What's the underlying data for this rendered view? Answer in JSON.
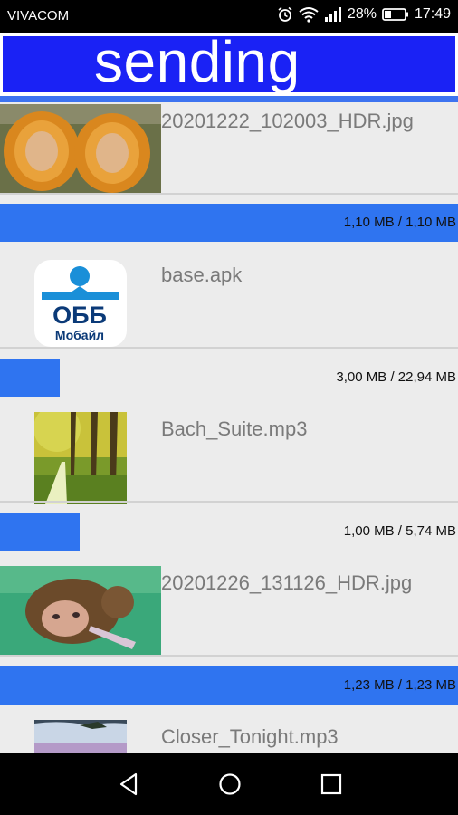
{
  "status_bar": {
    "carrier": "VIVACOM",
    "battery": "28%",
    "time": "17:49",
    "icons": [
      "alarm-icon",
      "wifi-icon",
      "signal-icon",
      "battery-icon"
    ]
  },
  "header": {
    "title": "sending"
  },
  "colors": {
    "header_bg": "#1a22f5",
    "progress_fill": "#2f74f0",
    "text_gray": "#7a7a7a"
  },
  "files": [
    {
      "name": "20201222_102003_HDR.jpg",
      "thumb": "pumpkin-photo",
      "progress_text": "1,10 MB / 1,10 MB",
      "progress_fraction": 1.0
    },
    {
      "name": "base.apk",
      "thumb": "obb-mobile-app-icon",
      "thumb_text_top": "ОББ",
      "thumb_text_bottom": "Мобайл",
      "progress_text": "3,00 MB / 22,94 MB",
      "progress_fraction": 0.13
    },
    {
      "name": "Bach_Suite.mp3",
      "thumb": "park-trees-photo",
      "progress_text": "1,00 MB / 5,74 MB",
      "progress_fraction": 0.174
    },
    {
      "name": "20201226_131126_HDR.jpg",
      "thumb": "curly-hair-doll-photo",
      "progress_text": "1,23 MB / 1,23 MB",
      "progress_fraction": 1.0
    },
    {
      "name": "Closer_Tonight.mp3",
      "thumb": "beach-palm-photo"
    }
  ],
  "nav": {
    "buttons": [
      "back-icon",
      "home-icon",
      "recents-icon"
    ]
  }
}
